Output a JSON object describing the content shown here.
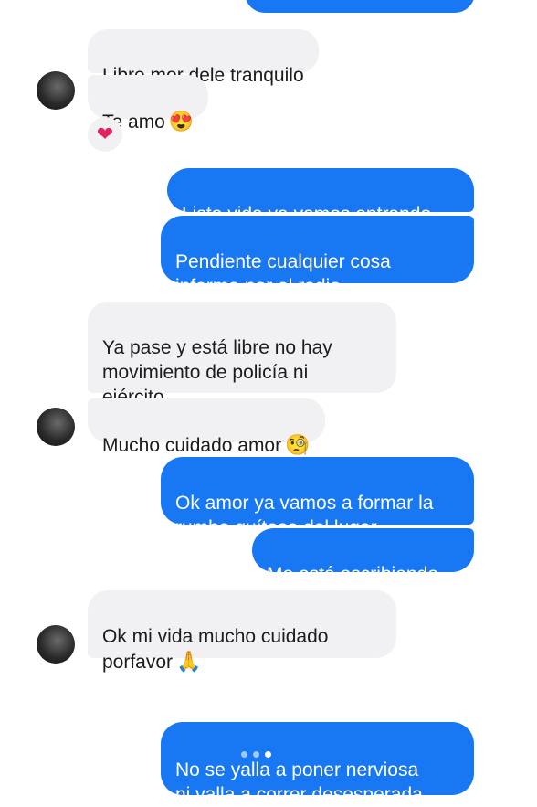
{
  "colors": {
    "outgoing": "#1877f2",
    "incoming": "#f1f1f3"
  },
  "messages": [
    {
      "id": "m1",
      "dir": "in",
      "text": "Libre mor dele tranquilo"
    },
    {
      "id": "m2",
      "dir": "in",
      "text": "Te amo",
      "emoji": "😍"
    },
    {
      "id": "m3",
      "dir": "out",
      "text": "Listo vida ya vamos entrando"
    },
    {
      "id": "m4",
      "dir": "out",
      "text": "Pendiente cualquier cosa\ninforma por el radio"
    },
    {
      "id": "m5",
      "dir": "in",
      "text": "Ya pase y está libre no hay\nmovimiento de policía ni\nejército"
    },
    {
      "id": "m6",
      "dir": "in",
      "text": "Mucho cuidado amor",
      "emoji": "🧐"
    },
    {
      "id": "m7",
      "dir": "out",
      "text": "Ok amor ya vamos a formar la\nrumba quítese del lugar"
    },
    {
      "id": "m8",
      "dir": "out",
      "text": "Me está escribiendo"
    },
    {
      "id": "m9",
      "dir": "in",
      "text": "Ok mi vida mucho cuidado\nporfavor",
      "emoji": "🙏"
    },
    {
      "id": "m10",
      "dir": "out",
      "text": "No se yalla a poner nerviosa\nni valla a correr desesperada"
    }
  ],
  "reaction": {
    "icon": "heart-icon",
    "glyph": "❤"
  }
}
